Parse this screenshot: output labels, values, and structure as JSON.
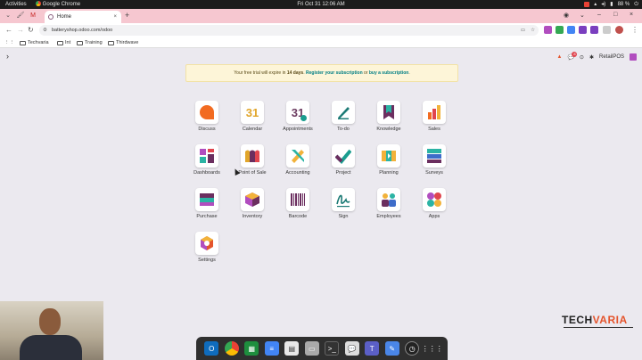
{
  "topbar": {
    "activities": "Activities",
    "app_name": "Google Chrome",
    "clock": "Fri Oct 31  12:06 AM",
    "battery": "88 %"
  },
  "browser": {
    "tab_title": "Home",
    "url": "batteryshop.odoo.com/odoo",
    "bookmarks": [
      "Techvaria",
      "Int",
      "Training",
      "Thirdwave"
    ]
  },
  "odoo_nav": {
    "notification_count": "8",
    "company": "RetailPOS"
  },
  "banner": {
    "prefix": "Your free trial will expire in ",
    "days": "14 days",
    "middle": ". ",
    "register_link": "Register your subscription",
    "or": " or ",
    "buy_link": "buy a subscription",
    "suffix": "."
  },
  "apps": [
    {
      "label": "Discuss",
      "icon": "discuss-icon"
    },
    {
      "label": "Calendar",
      "icon": "calendar-icon"
    },
    {
      "label": "Appointments",
      "icon": "appointments-icon"
    },
    {
      "label": "To-do",
      "icon": "todo-icon"
    },
    {
      "label": "Knowledge",
      "icon": "knowledge-icon"
    },
    {
      "label": "Sales",
      "icon": "sales-icon"
    },
    {
      "label": "Dashboards",
      "icon": "dashboards-icon"
    },
    {
      "label": "Point of Sale",
      "icon": "point-of-sale-icon"
    },
    {
      "label": "Accounting",
      "icon": "accounting-icon"
    },
    {
      "label": "Project",
      "icon": "project-icon"
    },
    {
      "label": "Planning",
      "icon": "planning-icon"
    },
    {
      "label": "Surveys",
      "icon": "surveys-icon"
    },
    {
      "label": "Purchase",
      "icon": "purchase-icon"
    },
    {
      "label": "Inventory",
      "icon": "inventory-icon"
    },
    {
      "label": "Barcode",
      "icon": "barcode-icon"
    },
    {
      "label": "Sign",
      "icon": "sign-icon"
    },
    {
      "label": "Employees",
      "icon": "employees-icon"
    },
    {
      "label": "Apps",
      "icon": "apps-icon"
    },
    {
      "label": "Settings",
      "icon": "settings-icon"
    }
  ],
  "calendar_day": "31",
  "appointments_day": "31",
  "watermark": {
    "part1": "TECH",
    "part2": "VARIA"
  },
  "colors": {
    "odoo_purple": "#875a7b",
    "link_teal": "#017e84",
    "tab_strip": "#f6c7d0"
  }
}
